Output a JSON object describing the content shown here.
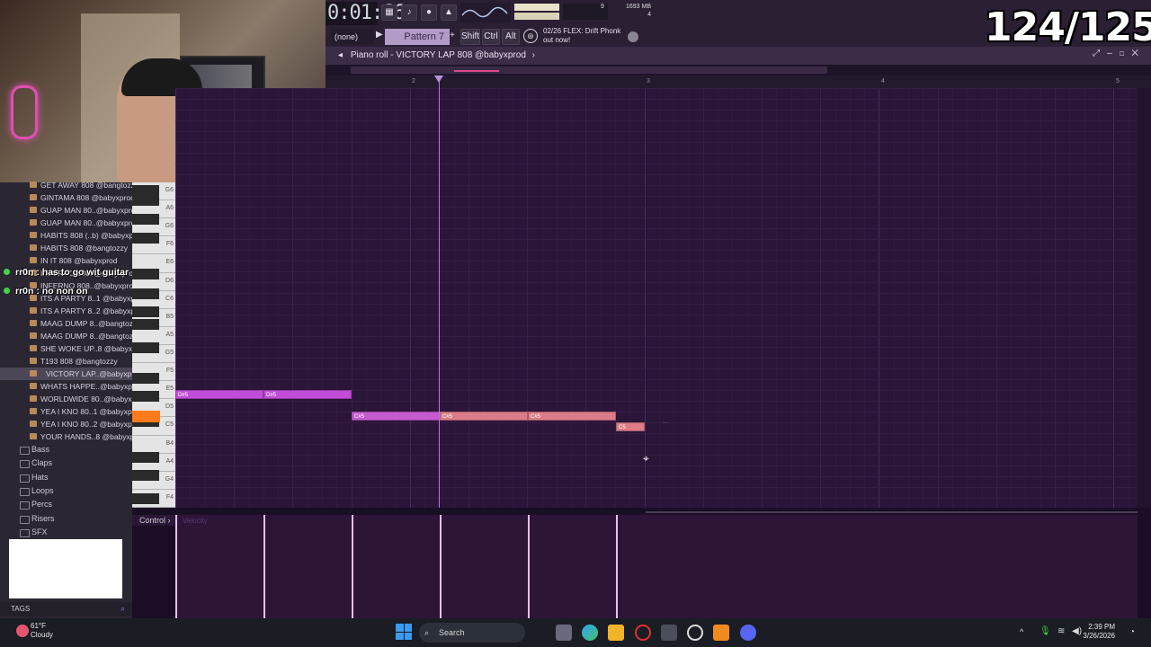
{
  "timer": {
    "display": "0:01:66",
    "unit": "M:S:CS"
  },
  "toolbar": {
    "pattern_selector": "(none)",
    "pattern_name": "Pattern 7",
    "shift_label": "Shift",
    "ctrl_label": "Ctrl",
    "alt_label": "Alt",
    "cpu_value": "9",
    "memory": "1693 MB",
    "voices": "4",
    "news_line1": "02/26  FLEX: Drift Phonk",
    "news_line2": "out now!"
  },
  "counter_overlay": "124/125",
  "piano_roll": {
    "title": "Piano roll - VICTORY LAP 808 @babyxprod",
    "ruler_marks": [
      "2",
      "3",
      "4",
      "5"
    ],
    "control_label": "Control",
    "control_param": "Velocity",
    "notes": [
      {
        "pitch": "D#5",
        "label": "D#5"
      },
      {
        "pitch": "D#5",
        "label": "D#5"
      },
      {
        "pitch": "C#5",
        "label": "C#5"
      },
      {
        "pitch": "C#5",
        "label": "C#5"
      },
      {
        "pitch": "C#5",
        "label": "C#5"
      },
      {
        "pitch": "C5",
        "label": "C5"
      }
    ]
  },
  "keyboard": {
    "labels": [
      "G6",
      "A6",
      "G6",
      "F6",
      "E6",
      "D6",
      "C6",
      "B5",
      "A5",
      "G5",
      "F5",
      "E5",
      "D5",
      "C5",
      "B4",
      "A4",
      "G4",
      "F4"
    ]
  },
  "browser": {
    "items": [
      "GET AWAY 808 @bangtozzy",
      "GINTAMA 808 @babyxprod",
      "GUAP MAN 80..@babyxprod",
      "GUAP MAN 80..@babyxprod",
      "HABITS 808 (..b) @babyxprod",
      "HABITS 808 @bangtozzy",
      "IN IT 808 @babyxprod",
      "INFERNO 808..@babyxprod",
      "INFERNO 808..@babyxprod",
      "ITS A PARTY 8..1 @babyxprod",
      "ITS A PARTY 8..2 @babyxprod",
      "MAAG DUMP 8..@bangtozzy",
      "MAAG DUMP 8..@bangtozzy",
      "SHE WOKE UP..8 @babyxprod",
      "T193 808 @bangtozzy",
      "VICTORY LAP..@babyxprod",
      "WHATS HAPPE..@babyxprod",
      "WORLDWIDE 80..@babyxprod",
      "YEA I KNO 80..1 @babyxprod",
      "YEA I KNO 80..2 @babyxprod",
      "YOUR HANDS..8 @babyxprod"
    ],
    "folders": [
      "Bass",
      "Claps",
      "Hats",
      "Loops",
      "Percs",
      "Risers",
      "SFX"
    ],
    "tags_label": "TAGS"
  },
  "chat": [
    {
      "user": "rr0n",
      "message": "has to go wit guitar"
    },
    {
      "user": "rr0n",
      "message": "no non on"
    }
  ],
  "taskbar": {
    "temperature": "61°F",
    "condition": "Cloudy",
    "search_placeholder": "Search",
    "time": "2:39 PM",
    "date": "3/26/2026"
  },
  "colors": {
    "grid_bg": "#2b1538",
    "note_purple": "#c04ed8",
    "note_salmon": "#dc7c88",
    "active_key": "#ff7a1a",
    "playhead": "#b67ad8"
  }
}
